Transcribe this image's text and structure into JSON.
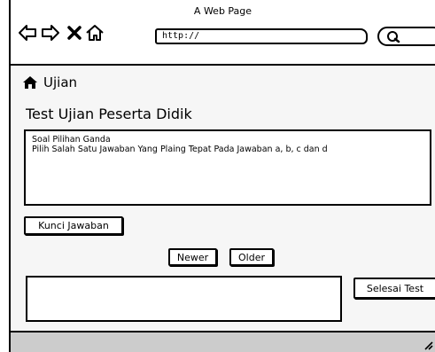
{
  "window": {
    "title": "A Web Page"
  },
  "browser": {
    "address": "http://",
    "icons": [
      "back-arrow-icon",
      "forward-arrow-icon",
      "close-icon",
      "home-icon",
      "search-icon"
    ]
  },
  "breadcrumb": {
    "icon": "home-icon",
    "label": "Ujian"
  },
  "page": {
    "title": "Test Ujian Peserta Didik"
  },
  "question": {
    "line1": "Soal Pilihan Ganda",
    "line2": "Pilih Salah Satu Jawaban Yang Plaing Tepat Pada Jawaban a, b, c dan d"
  },
  "buttons": {
    "answer_key": "Kunci Jawaban",
    "newer": "Newer",
    "older": "Older",
    "finish": "Selesai Test"
  },
  "answer": {
    "value": ""
  }
}
